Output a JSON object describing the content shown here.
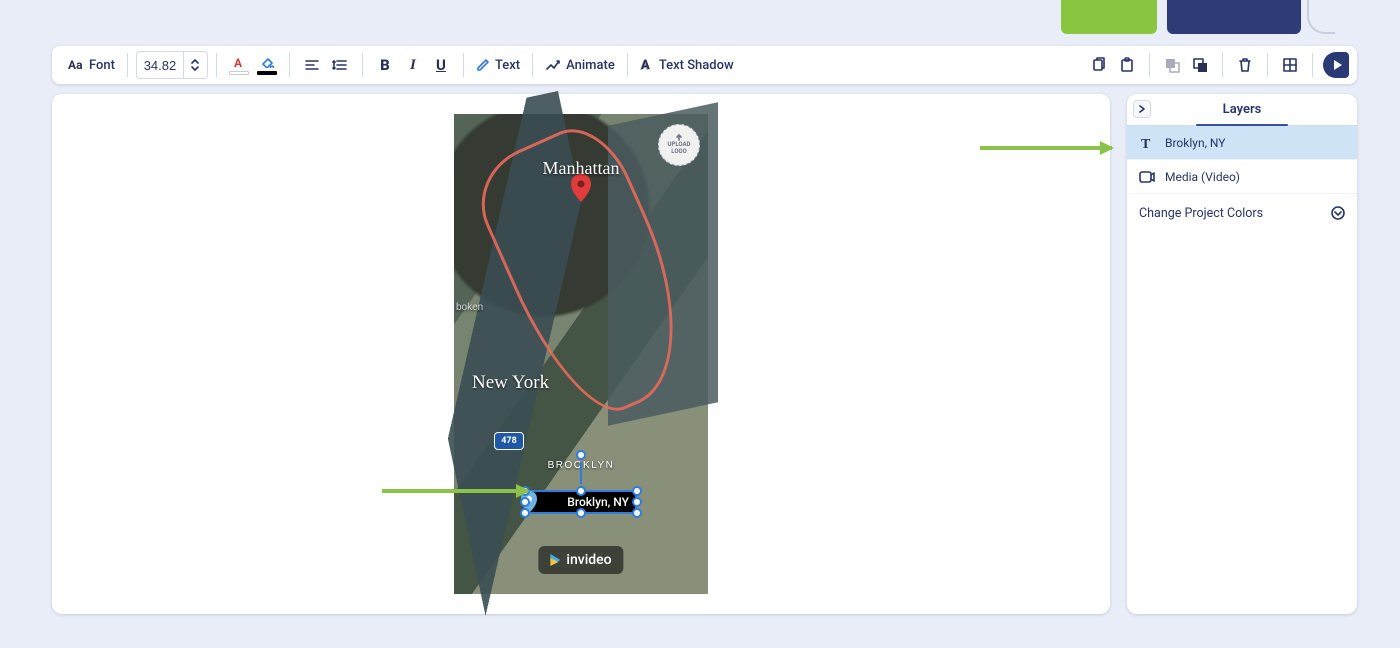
{
  "toolbar": {
    "font_label": "Font",
    "font_size": "34.82",
    "text_label": "Text",
    "animate_label": "Animate",
    "shadow_label": "Text Shadow"
  },
  "canvas": {
    "labels": {
      "manhattan": "Manhattan",
      "newyork": "New York",
      "brooklyn": "BROOKLYN",
      "boken": "boken"
    },
    "highway": "478",
    "upload_logo": {
      "line1": "UPLOAD",
      "line2": "LOGO"
    },
    "watermark": "invideo",
    "selected_text": "Broklyn, NY"
  },
  "layers": {
    "title": "Layers",
    "items": [
      {
        "type": "text",
        "label": "Broklyn, NY",
        "selected": true
      },
      {
        "type": "media",
        "label": "Media (Video)",
        "selected": false
      }
    ],
    "action": "Change Project Colors"
  }
}
